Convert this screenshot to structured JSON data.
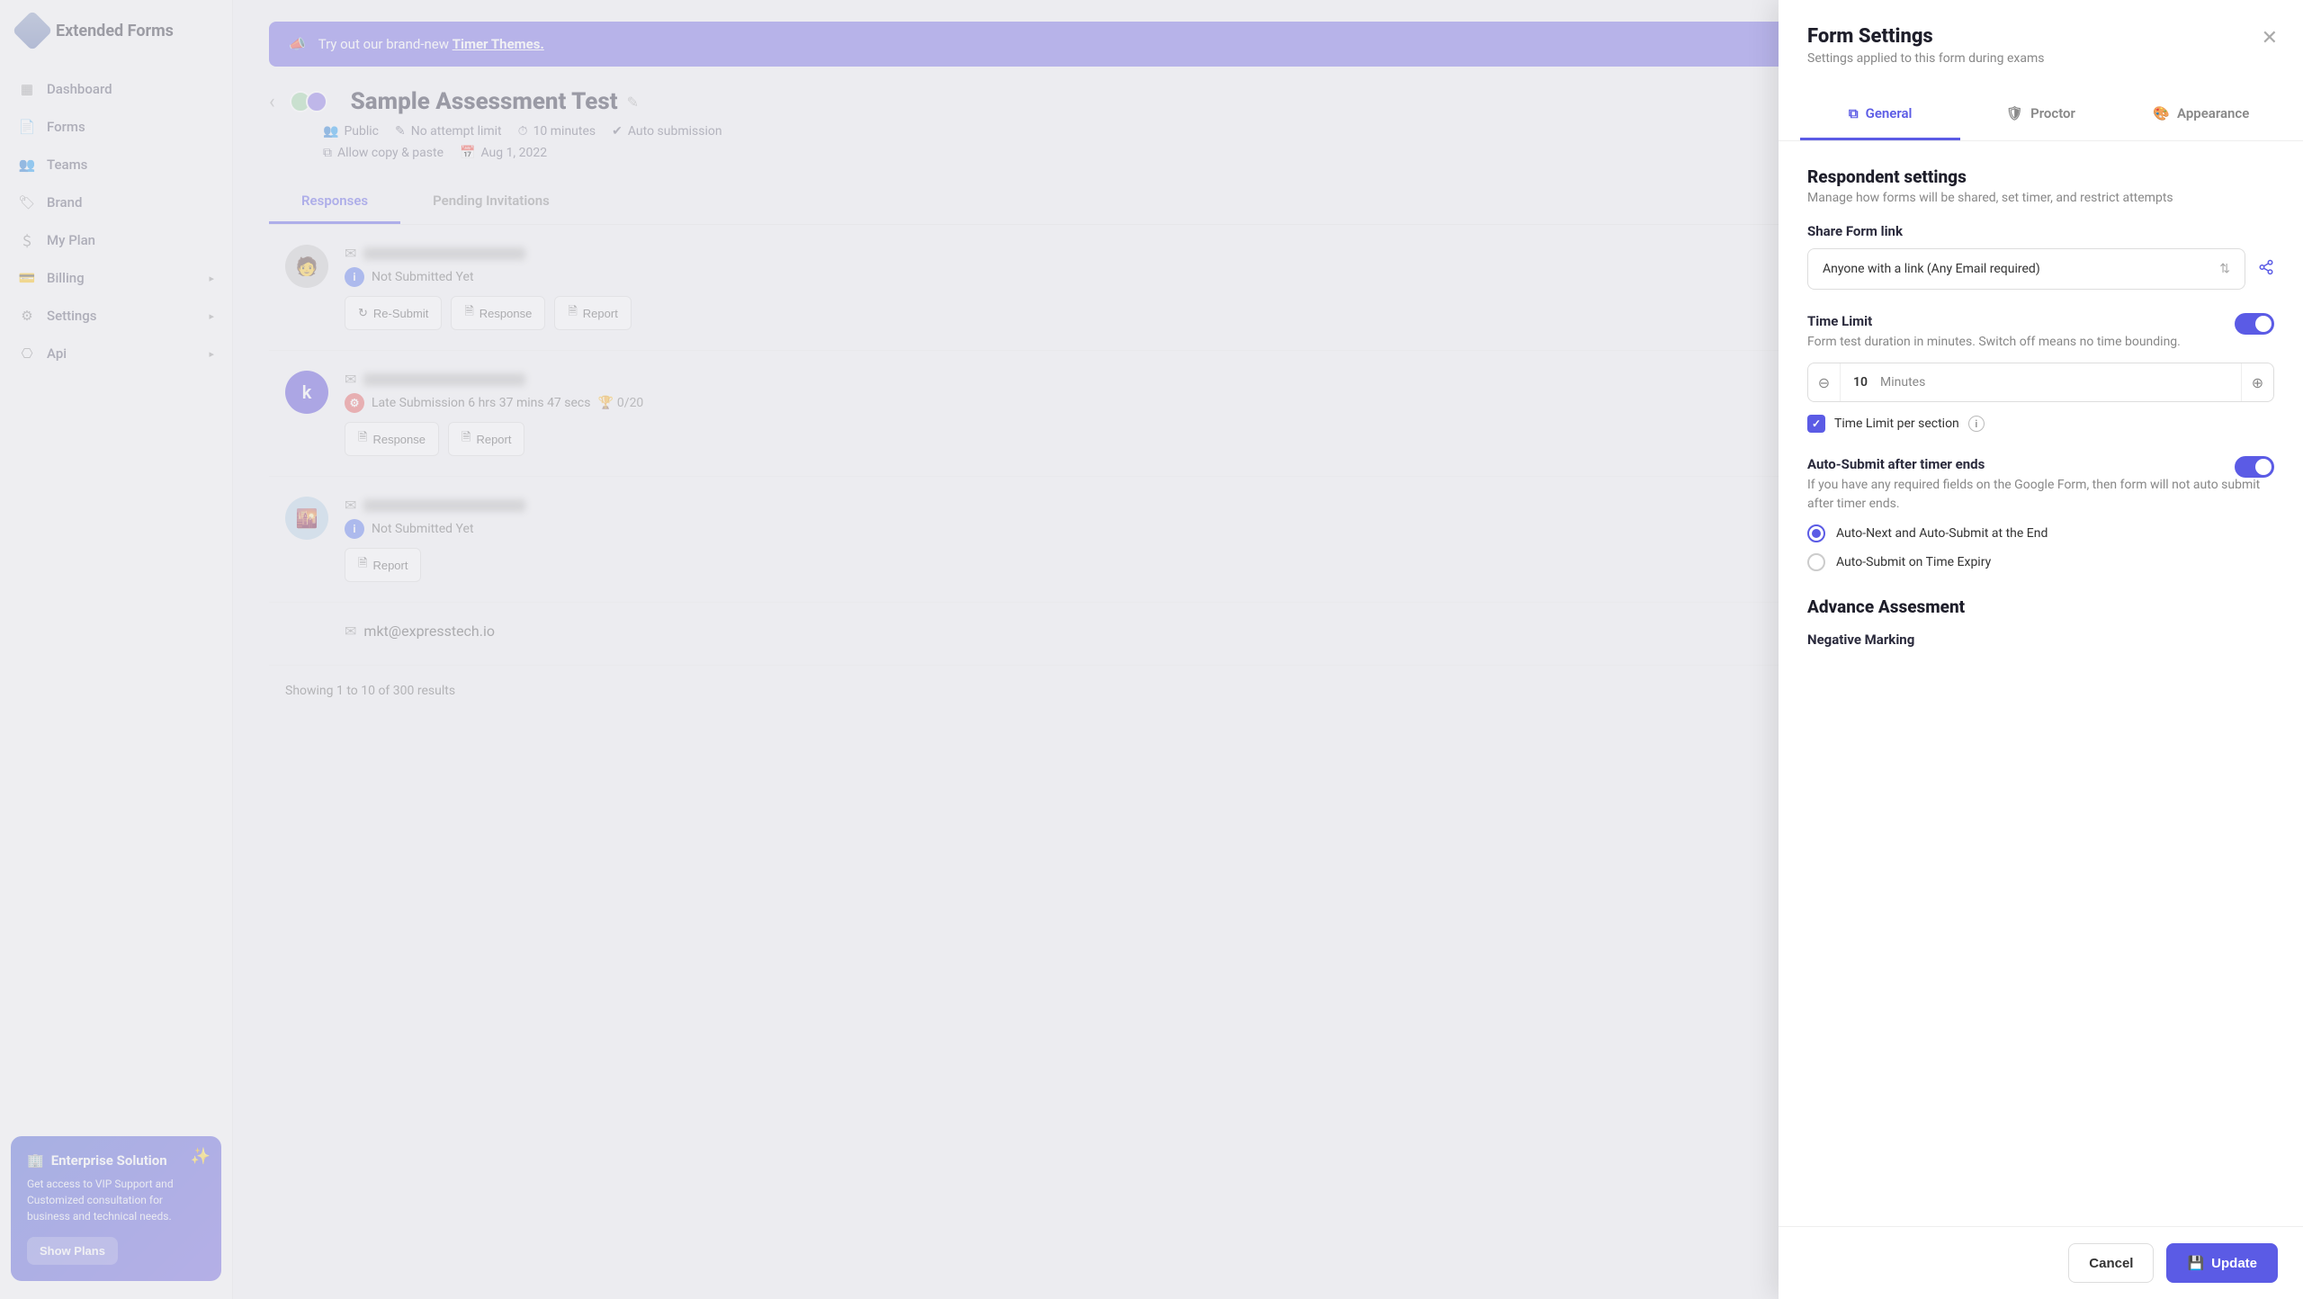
{
  "brand": "Extended Forms",
  "nav": {
    "dashboard": "Dashboard",
    "forms": "Forms",
    "teams": "Teams",
    "brand": "Brand",
    "my_plan": "My Plan",
    "billing": "Billing",
    "settings": "Settings",
    "api": "Api"
  },
  "upgrade": {
    "title": "Enterprise Solution",
    "desc": "Get access to VIP Support and Customized consultation for business and technical needs.",
    "btn": "Show Plans"
  },
  "banner": {
    "lead": "Try out our brand-new ",
    "link": "Timer Themes."
  },
  "form": {
    "title": "Sample Assessment Test",
    "meta": {
      "public": "Public",
      "attempt": "No attempt limit",
      "duration": "10 minutes",
      "submission": "Auto submission",
      "copy": "Allow copy & paste",
      "date": "Aug 1, 2022"
    }
  },
  "tabs": {
    "responses": "Responses",
    "pending": "Pending Invitations"
  },
  "rows": [
    {
      "status": "Not Submitted Yet",
      "kind": "info",
      "actions": [
        "Re-Submit",
        "Response",
        "Report"
      ]
    },
    {
      "status": "Late Submission 6 hrs 37 mins 47 secs",
      "kind": "late",
      "score": "0/20",
      "actions": [
        "Response",
        "Report"
      ]
    },
    {
      "status": "Not Submitted Yet",
      "kind": "info",
      "actions": [
        "Report"
      ]
    },
    {
      "email": "mkt@expresstech.io",
      "actions": []
    }
  ],
  "pagination": "Showing 1 to 10 of 300 results",
  "drawer": {
    "title": "Form Settings",
    "subtitle": "Settings applied to this form during exams",
    "tabs": {
      "general": "General",
      "proctor": "Proctor",
      "appearance": "Appearance"
    },
    "respondent": {
      "title": "Respondent settings",
      "sub": "Manage how forms will be shared, set timer, and restrict attempts"
    },
    "share": {
      "label": "Share Form link",
      "value": "Anyone with a link (Any Email required)"
    },
    "time_limit": {
      "label": "Time Limit",
      "desc": "Form test duration in minutes. Switch off means no time bounding.",
      "value": "10",
      "unit": "Minutes",
      "per_section": "Time Limit per section"
    },
    "auto_submit": {
      "label": "Auto-Submit after timer ends",
      "desc": "If you have any required fields on the Google Form, then form will not auto submit after timer ends.",
      "opt1": "Auto-Next and Auto-Submit at the End",
      "opt2": "Auto-Submit on Time Expiry"
    },
    "advance": {
      "title": "Advance Assesment",
      "neg": "Negative Marking"
    },
    "buttons": {
      "cancel": "Cancel",
      "update": "Update"
    }
  }
}
